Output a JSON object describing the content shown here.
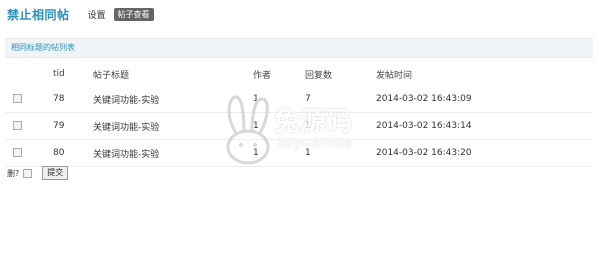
{
  "header": {
    "title": "禁止相同帖",
    "nav_settings": "设置",
    "nav_active": "帖子查看"
  },
  "panel": {
    "title": "相同标题的帖列表"
  },
  "table": {
    "columns": {
      "tid": "tid",
      "subject": "帖子标题",
      "author": "作者",
      "replies": "回复数",
      "posted": "发帖时间"
    },
    "rows": [
      {
        "tid": "78",
        "subject": "关键词功能-实验",
        "author": "1",
        "replies": "7",
        "posted": "2014-03-02 16:43:09"
      },
      {
        "tid": "79",
        "subject": "关键词功能-实验",
        "author": "1",
        "replies": "1",
        "posted": "2014-03-02 16:43:14"
      },
      {
        "tid": "80",
        "subject": "关键词功能-实验",
        "author": "1",
        "replies": "1",
        "posted": "2014-03-02 16:43:20"
      }
    ]
  },
  "footer": {
    "select_all": "删?",
    "submit": "提交"
  },
  "watermark": {
    "main": "兔源码",
    "sub": "tuyuanma"
  }
}
